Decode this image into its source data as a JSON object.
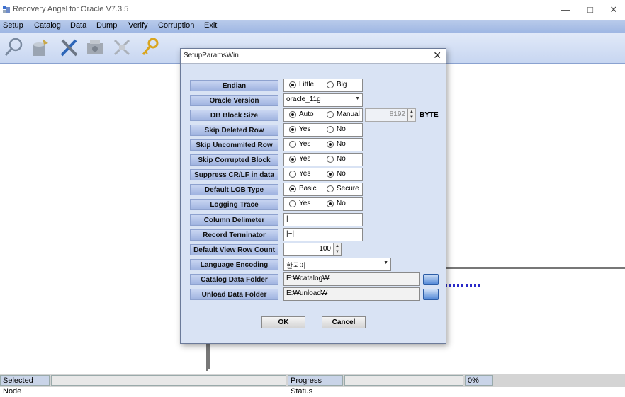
{
  "window": {
    "title": "Recovery Angel for Oracle V7.3.5",
    "minimize": "—",
    "maximize": "□",
    "close": "✕"
  },
  "menu": [
    "Setup",
    "Catalog",
    "Data",
    "Dump",
    "Verify",
    "Corruption",
    "Exit"
  ],
  "toolbar_icons": [
    "search-icon",
    "database-icon",
    "tools-icon",
    "machine-icon",
    "crossed-tools-icon",
    "key-icon"
  ],
  "dialog": {
    "title": "SetupParamsWin",
    "close": "✕",
    "rows": {
      "endian": {
        "label": "Endian",
        "opt1": "Little",
        "opt2": "Big",
        "selected": "Little"
      },
      "oracle_version": {
        "label": "Oracle Version",
        "value": "oracle_11g"
      },
      "block_size": {
        "label": "DB Block Size",
        "opt1": "Auto",
        "opt2": "Manual",
        "selected": "Auto",
        "number": "8192",
        "unit": "BYTE"
      },
      "skip_deleted": {
        "label": "Skip Deleted Row",
        "opt1": "Yes",
        "opt2": "No",
        "selected": "Yes"
      },
      "skip_uncommited": {
        "label": "Skip Uncommited Row",
        "opt1": "Yes",
        "opt2": "No",
        "selected": "No"
      },
      "skip_corrupted": {
        "label": "Skip Corrupted Block",
        "opt1": "Yes",
        "opt2": "No",
        "selected": "Yes"
      },
      "suppress_crlf": {
        "label": "Suppress CR/LF in data",
        "opt1": "Yes",
        "opt2": "No",
        "selected": "No"
      },
      "lob_type": {
        "label": "Default LOB Type",
        "opt1": "Basic",
        "opt2": "Secure",
        "selected": "Basic"
      },
      "logging": {
        "label": "Logging Trace",
        "opt1": "Yes",
        "opt2": "No",
        "selected": "No"
      },
      "col_delim": {
        "label": "Column Delimeter",
        "value": "|"
      },
      "rec_term": {
        "label": "Record Terminator",
        "value": "|~|"
      },
      "view_rows": {
        "label": "Default View Row Count",
        "value": "100"
      },
      "lang_enc": {
        "label": "Language Encoding",
        "value": "한국어"
      },
      "catalog_folder": {
        "label": "Catalog Data Folder",
        "value": "E:₩catalog₩"
      },
      "unload_folder": {
        "label": "Unload Data Folder",
        "value": "E:₩unload₩"
      }
    },
    "ok": "OK",
    "cancel": "Cancel"
  },
  "status": {
    "selected_node": "Selected Node",
    "progress_label": "Progress Status",
    "progress_value": "0%"
  }
}
